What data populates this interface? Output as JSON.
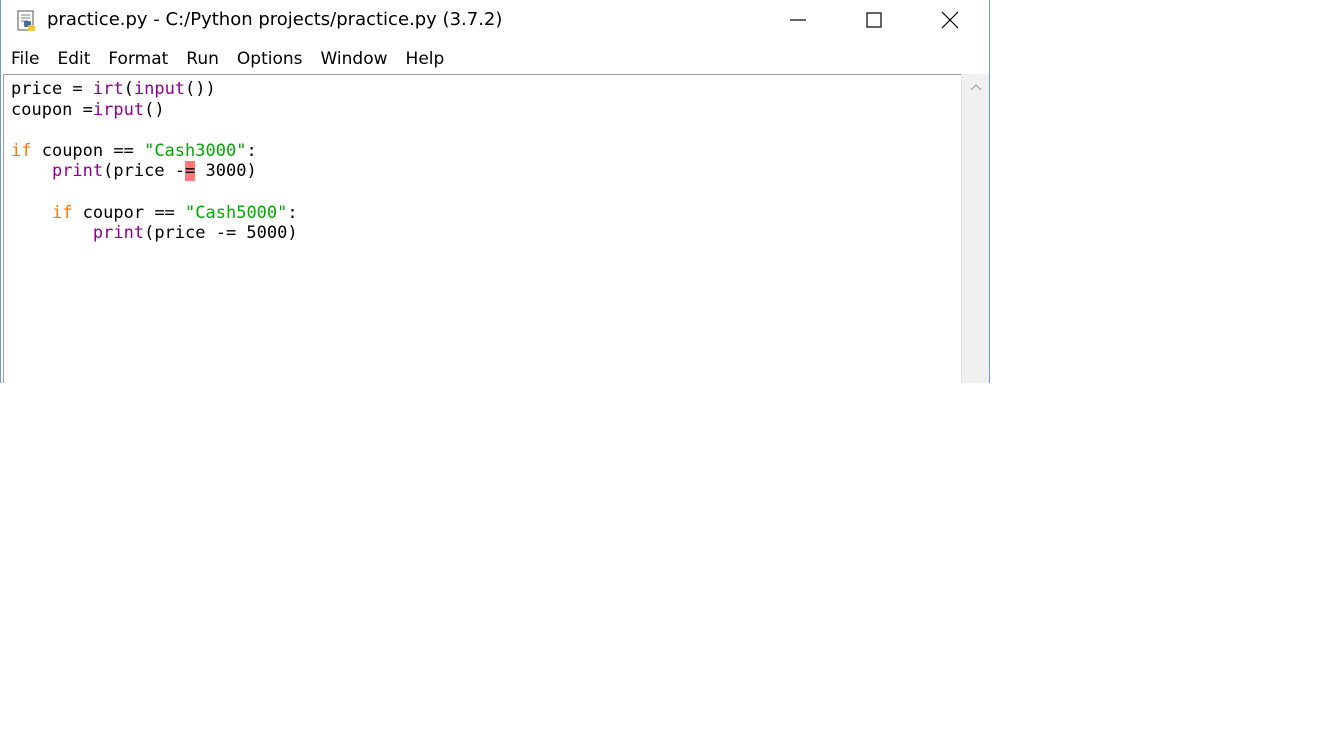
{
  "window": {
    "title": "practice.py - C:/Python projects/practice.py (3.7.2)"
  },
  "title_icon": "idle-python-file-icon",
  "window_controls": {
    "minimize_icon": "minimize-icon",
    "maximize_icon": "maximize-icon",
    "close_icon": "close-icon"
  },
  "menu": {
    "items": [
      {
        "label": "File"
      },
      {
        "label": "Edit"
      },
      {
        "label": "Format"
      },
      {
        "label": "Run"
      },
      {
        "label": "Options"
      },
      {
        "label": "Window"
      },
      {
        "label": "Help"
      }
    ]
  },
  "code": {
    "lines": [
      [
        {
          "t": "price = ",
          "c": ""
        },
        {
          "t": "irt",
          "c": "bi"
        },
        {
          "t": "(",
          "c": ""
        },
        {
          "t": "input",
          "c": "bi"
        },
        {
          "t": "())",
          "c": ""
        }
      ],
      [
        {
          "t": "coupon =",
          "c": ""
        },
        {
          "t": "irput",
          "c": "bi"
        },
        {
          "t": "()",
          "c": ""
        }
      ],
      [],
      [
        {
          "t": "if",
          "c": "kw"
        },
        {
          "t": " coupon == ",
          "c": ""
        },
        {
          "t": "\"Cash3000\"",
          "c": "str"
        },
        {
          "t": ":",
          "c": ""
        }
      ],
      [
        {
          "t": "    ",
          "c": ""
        },
        {
          "t": "print",
          "c": "bi"
        },
        {
          "t": "(price -",
          "c": ""
        },
        {
          "t": "=",
          "c": "err"
        },
        {
          "t": " 3000)",
          "c": ""
        }
      ],
      [],
      [
        {
          "t": "    ",
          "c": ""
        },
        {
          "t": "if",
          "c": "kw"
        },
        {
          "t": " coupor == ",
          "c": ""
        },
        {
          "t": "\"Cash5000\"",
          "c": "str"
        },
        {
          "t": ":",
          "c": ""
        }
      ],
      [
        {
          "t": "        ",
          "c": ""
        },
        {
          "t": "print",
          "c": "bi"
        },
        {
          "t": "(price -= 5000)",
          "c": ""
        }
      ]
    ]
  },
  "colors": {
    "keyword": "#ff7700",
    "builtin": "#900090",
    "string": "#00aa00",
    "error_highlight": "#ff7777"
  },
  "scrollbar": {
    "up_icon": "chevron-up-icon"
  }
}
